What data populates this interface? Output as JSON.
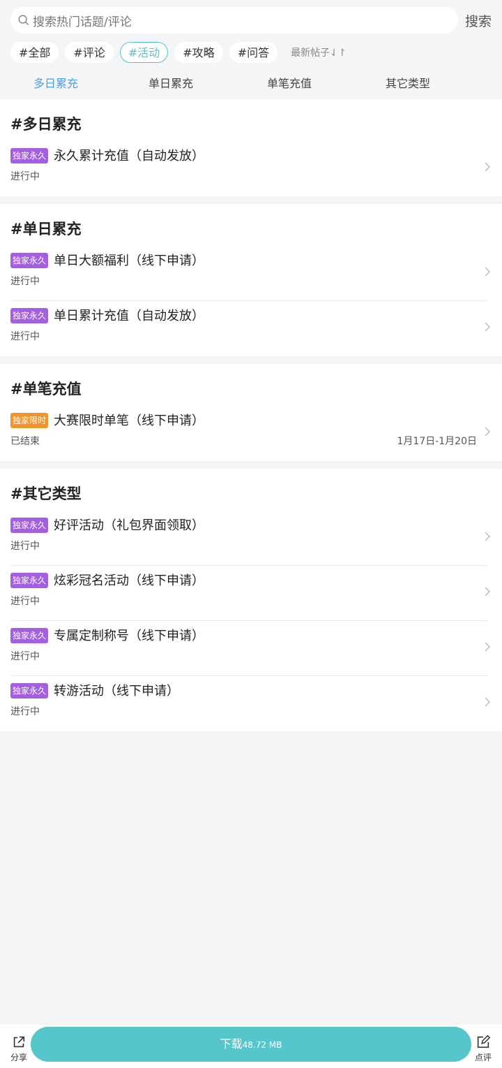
{
  "search": {
    "placeholder": "搜索热门话题/评论",
    "button": "搜索"
  },
  "chips": [
    "#全部",
    "#评论",
    "#活动",
    "#攻略",
    "#问答"
  ],
  "chips_active_index": 2,
  "sort_label": "最新帖子⇃↾",
  "tabs": [
    "多日累充",
    "单日累充",
    "单笔充值",
    "其它类型"
  ],
  "tabs_active_index": 0,
  "sections": [
    {
      "title": "#多日累充",
      "items": [
        {
          "tag": "独家永久",
          "name": "永久累计充值（自动发放）",
          "status": "进行中"
        }
      ]
    },
    {
      "title": "#单日累充",
      "items": [
        {
          "tag": "独家永久",
          "name": "单日大额福利（线下申请）",
          "status": "进行中"
        },
        {
          "tag": "独家永久",
          "name": "单日累计充值（自动发放）",
          "status": "进行中"
        }
      ]
    },
    {
      "title": "#单笔充值",
      "items": [
        {
          "tag": "独家限时",
          "name": "大赛限时单笔（线下申请）",
          "status": "已结束",
          "date": "1月17日-1月20日"
        }
      ]
    },
    {
      "title": "#其它类型",
      "items": [
        {
          "tag": "独家永久",
          "name": "好评活动（礼包界面领取）",
          "status": "进行中"
        },
        {
          "tag": "独家永久",
          "name": "炫彩冠名活动（线下申请）",
          "status": "进行中"
        },
        {
          "tag": "独家永久",
          "name": "专属定制称号（线下申请）",
          "status": "进行中"
        },
        {
          "tag": "独家永久",
          "name": "转游活动（线下申请）",
          "status": "进行中"
        }
      ]
    }
  ],
  "colors": {
    "accent": "#56c5cc",
    "tab_active": "#4aa3e0",
    "tag_permanent": "#a35fe0",
    "tag_limited": "#f0952e"
  },
  "bottom_bar": {
    "share": "分享",
    "download": "下载",
    "download_size": "48.72 MB",
    "review": "点评"
  }
}
